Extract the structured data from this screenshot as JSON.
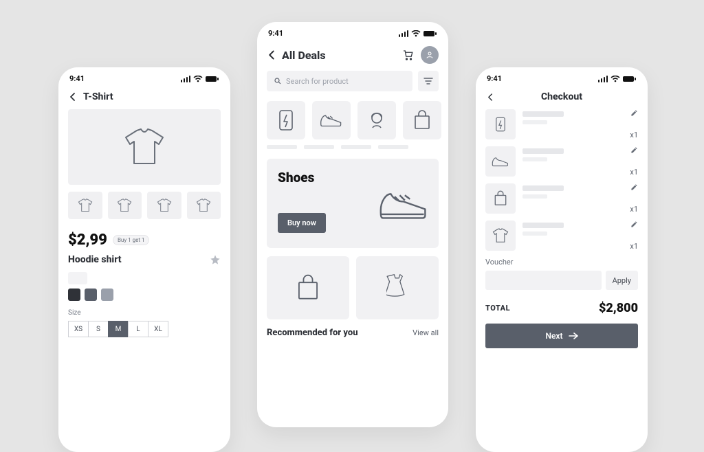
{
  "status": {
    "time": "9:41"
  },
  "product": {
    "header_title": "T-Shirt",
    "price": "$2,99",
    "promo_badge": "Buy 1 get 1",
    "name": "Hoodie shirt",
    "color_label": "",
    "swatches": [
      "#2f3238",
      "#595f6a",
      "#9aa0ab"
    ],
    "size_label": "Size",
    "sizes": [
      "XS",
      "S",
      "M",
      "L",
      "XL"
    ],
    "selected_size": "M"
  },
  "deals": {
    "header_title": "All Deals",
    "search_placeholder": "Search for product",
    "promo_title": "Shoes",
    "buy_label": "Buy now",
    "recommended_title": "Recommended for you",
    "view_all": "View all"
  },
  "checkout": {
    "header_title": "Checkout",
    "items": [
      {
        "icon": "battery",
        "qty": "x1"
      },
      {
        "icon": "shoe",
        "qty": "x1"
      },
      {
        "icon": "bag",
        "qty": "x1"
      },
      {
        "icon": "tshirt",
        "qty": "x1"
      }
    ],
    "voucher_label": "Voucher",
    "apply_label": "Apply",
    "total_label": "TOTAL",
    "total_value": "$2,800",
    "next_label": "Next"
  }
}
